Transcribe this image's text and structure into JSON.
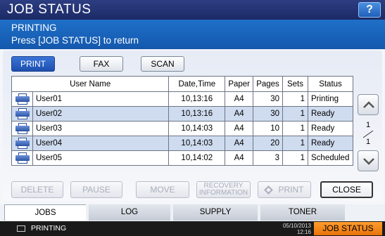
{
  "header": {
    "title": "JOB STATUS",
    "help_label": "?"
  },
  "message": {
    "line1": "PRINTING",
    "line2": "Press [JOB STATUS] to return"
  },
  "tabs": [
    {
      "label": "PRINT",
      "active": true
    },
    {
      "label": "FAX",
      "active": false
    },
    {
      "label": "SCAN",
      "active": false
    }
  ],
  "table": {
    "columns": [
      "User Name",
      "Date,Time",
      "Paper",
      "Pages",
      "Sets",
      "Status"
    ],
    "rows": [
      {
        "user": "User01",
        "datetime": "10,13:16",
        "paper": "A4",
        "pages": "30",
        "sets": "1",
        "status": "Printing"
      },
      {
        "user": "User02",
        "datetime": "10,13:16",
        "paper": "A4",
        "pages": "30",
        "sets": "1",
        "status": "Ready"
      },
      {
        "user": "User03",
        "datetime": "10,14:03",
        "paper": "A4",
        "pages": "10",
        "sets": "1",
        "status": "Ready"
      },
      {
        "user": "User04",
        "datetime": "10,14:03",
        "paper": "A4",
        "pages": "20",
        "sets": "1",
        "status": "Ready"
      },
      {
        "user": "User05",
        "datetime": "10,14:02",
        "paper": "A4",
        "pages": "3",
        "sets": "1",
        "status": "Scheduled"
      }
    ]
  },
  "pager": {
    "current": "1",
    "total": "1"
  },
  "actions": {
    "delete": "DELETE",
    "pause": "PAUSE",
    "move": "MOVE",
    "recovery_line1": "RECOVERY",
    "recovery_line2": "INFORMATION",
    "print": "PRINT",
    "close": "CLOSE"
  },
  "bottom_tabs": [
    {
      "label": "JOBS",
      "active": true
    },
    {
      "label": "LOG",
      "active": false
    },
    {
      "label": "SUPPLY",
      "active": false
    },
    {
      "label": "TONER",
      "active": false
    }
  ],
  "statusbar": {
    "text": "PRINTING",
    "date": "05/10/2013",
    "time": "12:16",
    "job_status_button": "JOB STATUS"
  },
  "colors": {
    "accent": "#1f6fc8",
    "title_bg": "#1c2a66",
    "job_status_btn": "#f08a1c",
    "row_alt": "#cfdcef"
  }
}
